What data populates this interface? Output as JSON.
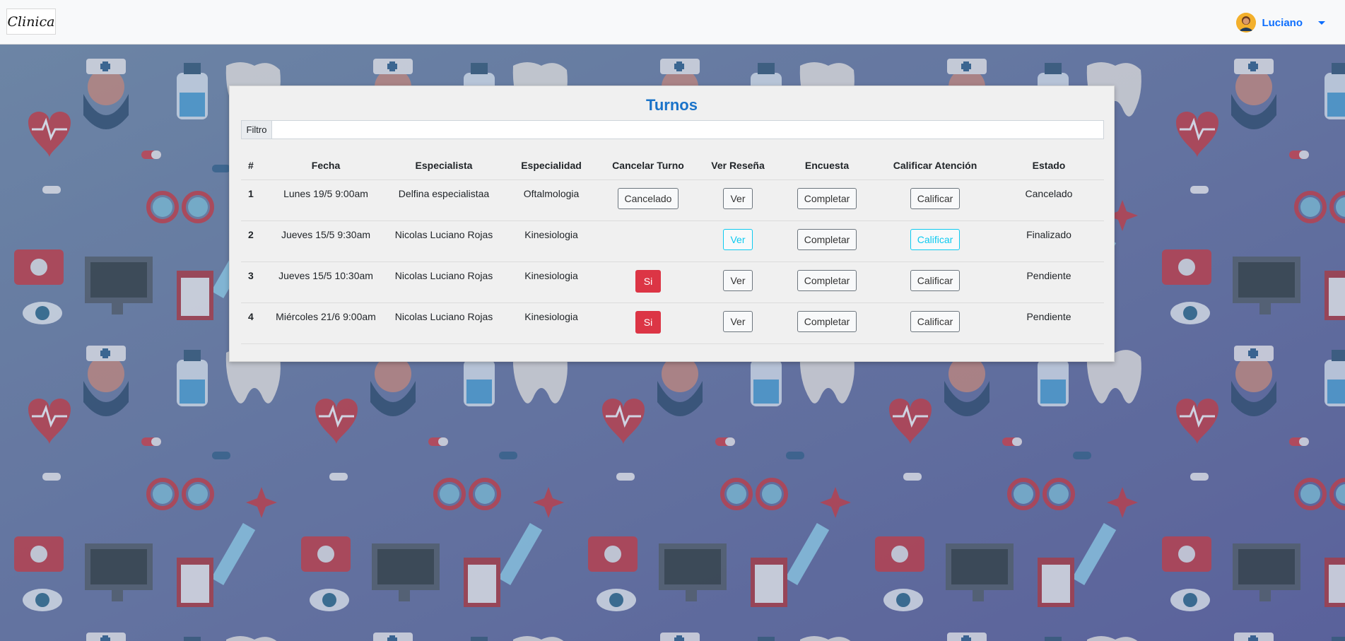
{
  "brand": {
    "logo_text": "Clinica"
  },
  "user": {
    "name": "Luciano"
  },
  "card": {
    "title": "Turnos"
  },
  "filter": {
    "label": "Filtro",
    "value": "",
    "placeholder": ""
  },
  "table": {
    "headers": [
      "#",
      "Fecha",
      "Especialista",
      "Especialidad",
      "Cancelar Turno",
      "Ver Reseña",
      "Encuesta",
      "Calificar Atención",
      "Estado"
    ],
    "rows": [
      {
        "num": "1",
        "fecha": "Lunes 19/5 9:00am",
        "especialista": "Delfina especialistaa",
        "especialidad": "Oftalmologia",
        "cancel": "Cancelado",
        "ver": "Ver",
        "encuesta": "Completar",
        "calificar": "Calificar",
        "estado": "Cancelado"
      },
      {
        "num": "2",
        "fecha": "Jueves 15/5 9:30am",
        "especialista": "Nicolas Luciano Rojas",
        "especialidad": "Kinesiologia",
        "cancel": "",
        "ver": "Ver",
        "encuesta": "Completar",
        "calificar": "Calificar",
        "estado": "Finalizado"
      },
      {
        "num": "3",
        "fecha": "Jueves 15/5 10:30am",
        "especialista": "Nicolas Luciano Rojas",
        "especialidad": "Kinesiologia",
        "cancel": "Si",
        "ver": "Ver",
        "encuesta": "Completar",
        "calificar": "Calificar",
        "estado": "Pendiente"
      },
      {
        "num": "4",
        "fecha": "Miércoles 21/6 9:00am",
        "especialista": "Nicolas Luciano Rojas",
        "especialidad": "Kinesiologia",
        "cancel": "Si",
        "ver": "Ver",
        "encuesta": "Completar",
        "calificar": "Calificar",
        "estado": "Pendiente"
      }
    ]
  },
  "colors": {
    "accent": "#1a73c9",
    "danger": "#dc3545",
    "info": "#0dcaf0",
    "background": "#5a6e94"
  }
}
